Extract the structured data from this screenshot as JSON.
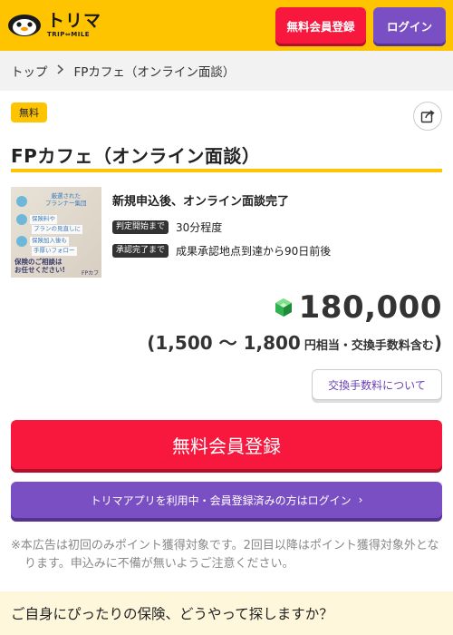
{
  "header": {
    "logo_main": "トリマ",
    "logo_sub": "TRIP⇔MILE",
    "register_label": "無料会員登録",
    "login_label": "ログイン"
  },
  "breadcrumb": {
    "home": "トップ",
    "current": "FPカフェ（オンライン面談）"
  },
  "offer": {
    "badge": "無料",
    "title": "FPカフェ（オンライン面談）",
    "thumbnail": {
      "heading": [
        "厳選された",
        "プランナー集団"
      ],
      "tags": [
        "保険料や",
        "プランの見直しに",
        "保険加入後も",
        "手厚いフォロー"
      ],
      "bottom": [
        "保険のご相談は",
        "お任せください!"
      ],
      "brand": "FPカフェ"
    },
    "condition": "新規申込後、オンライン面談完了",
    "rows": [
      {
        "tag": "判定開始まで",
        "value": "30分程度"
      },
      {
        "tag": "承認完了まで",
        "value": "成果承認地点到達から90日前後"
      }
    ],
    "points": "180,000",
    "yen_open": "(",
    "yen_range": "1,500 〜 1,800",
    "yen_suffix": "円相当・交換手数料含む",
    "yen_close": ")",
    "fee_button": "交換手数料について"
  },
  "actions": {
    "register_main": "無料会員登録",
    "login_main": "トリマアプリを利用中・会員登録済みの方はログイン",
    "chevron": "›"
  },
  "notice": "※本広告は初回のみポイント獲得対象です。2回目以降はポイント獲得対象外となります。申込みに不備が無いようご注意ください。",
  "bottom_banner": "ご自身にぴったりの保険、どうやって探しますか？",
  "colors": {
    "brand_yellow": "#ffc400",
    "register_red": "#f8173d",
    "login_purple": "#7b4fc4"
  },
  "icons": [
    "penguin-logo-icon",
    "chevron-right-icon",
    "share-icon",
    "gem-icon"
  ]
}
